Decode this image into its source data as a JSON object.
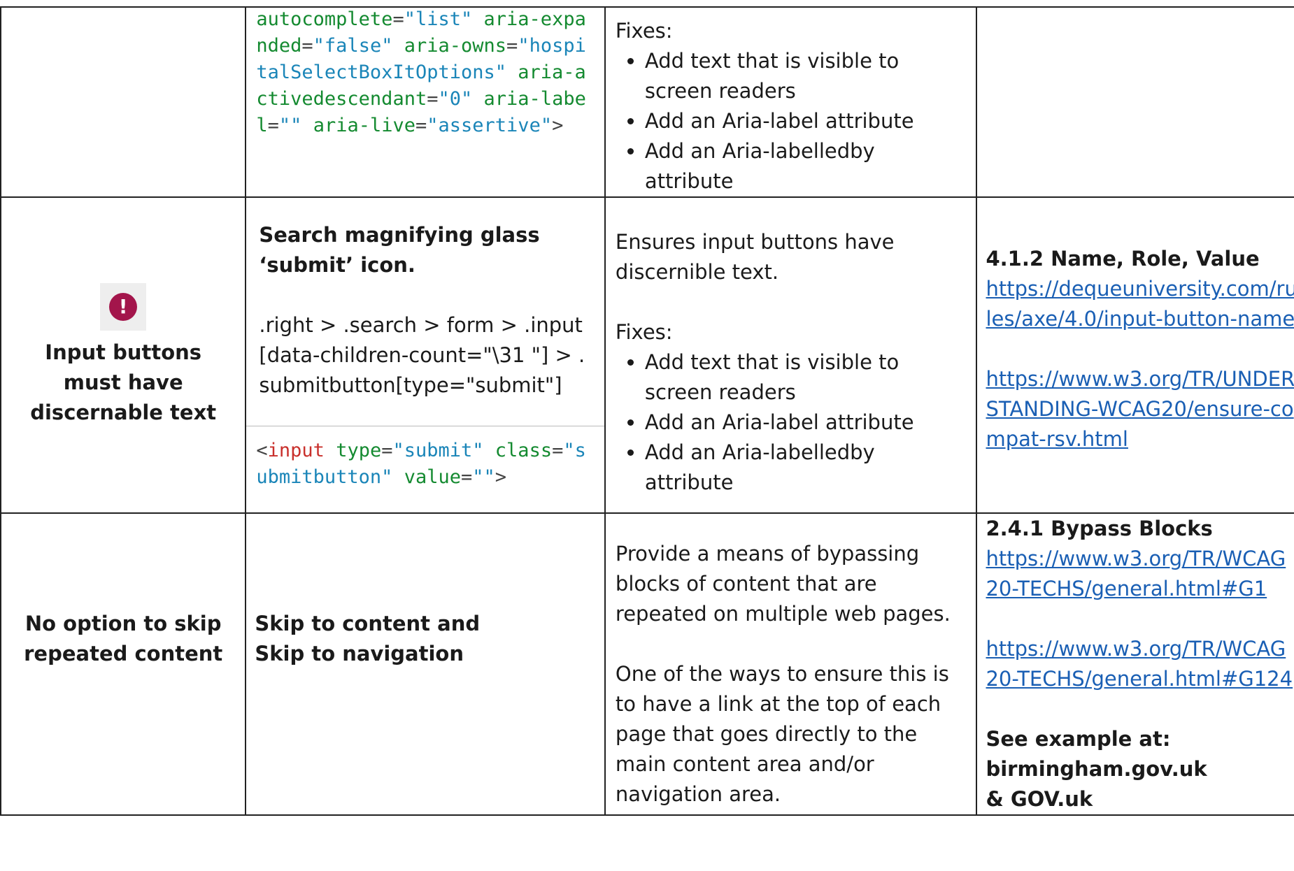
{
  "row1": {
    "code_parts": [
      {
        "t": "attr",
        "v": "autocomplete"
      },
      {
        "t": "p",
        "v": "="
      },
      {
        "t": "str",
        "v": "\"list\""
      },
      {
        "t": "sp",
        "v": " "
      },
      {
        "t": "attr",
        "v": "aria-expanded"
      },
      {
        "t": "p",
        "v": "="
      },
      {
        "t": "str",
        "v": "\"false\""
      },
      {
        "t": "sp",
        "v": " "
      },
      {
        "t": "attr",
        "v": "aria-owns"
      },
      {
        "t": "p",
        "v": "="
      },
      {
        "t": "str",
        "v": "\"hospitalSelectBoxItOptions\""
      },
      {
        "t": "sp",
        "v": " "
      },
      {
        "t": "attr",
        "v": "aria-activedescendant"
      },
      {
        "t": "p",
        "v": "="
      },
      {
        "t": "str",
        "v": "\"0\""
      },
      {
        "t": "sp",
        "v": " "
      },
      {
        "t": "attr",
        "v": "aria-label"
      },
      {
        "t": "p",
        "v": "="
      },
      {
        "t": "str",
        "v": "\"\""
      },
      {
        "t": "sp",
        "v": " "
      },
      {
        "t": "attr",
        "v": "aria-live"
      },
      {
        "t": "p",
        "v": "="
      },
      {
        "t": "str",
        "v": "\"assertive\""
      },
      {
        "t": "p",
        "v": ">"
      }
    ],
    "fixes_label": "Fixes:",
    "fixes": [
      "Add text that is visible to screen readers",
      "Add an Aria-label attribute",
      "Add an Aria-labelledby attribute"
    ]
  },
  "row2": {
    "issue": "Input buttons must have discernable text",
    "icon": "exclamation-circle-icon",
    "icon_glyph": "!",
    "element_title": "Search magnifying glass ‘submit’ icon.",
    "selector": ".right > .search > form > .input[data-children-count=\"\\31 \"] > .submitbutton[type=\"submit\"]",
    "code_parts": [
      {
        "t": "p",
        "v": "<"
      },
      {
        "t": "tag",
        "v": "input"
      },
      {
        "t": "sp",
        "v": " "
      },
      {
        "t": "attr",
        "v": "type"
      },
      {
        "t": "p",
        "v": "="
      },
      {
        "t": "str",
        "v": "\"submit\""
      },
      {
        "t": "sp",
        "v": " "
      },
      {
        "t": "attr",
        "v": "class"
      },
      {
        "t": "p",
        "v": "="
      },
      {
        "t": "str",
        "v": "\"submitbutton\""
      },
      {
        "t": "sp",
        "v": " "
      },
      {
        "t": "attr",
        "v": "value"
      },
      {
        "t": "p",
        "v": "="
      },
      {
        "t": "str",
        "v": "\"\""
      },
      {
        "t": "p",
        "v": ">"
      }
    ],
    "description": "Ensures input buttons have discernible text.",
    "fixes_label": "Fixes:",
    "fixes": [
      "Add text that is visible to screen readers",
      "Add an Aria-label attribute",
      "Add an Aria-labelledby attribute"
    ],
    "ref_title": "4.1.2 Name, Role, Value",
    "links": [
      "https://dequeuniversity.com/rules/axe/4.0/input-button-name",
      "https://www.w3.org/TR/UNDERSTANDING-WCAG20/ensure-compat-rsv.html"
    ]
  },
  "row3": {
    "issue": "No option to skip repeated content",
    "element_line1": "Skip to content and",
    "element_line2": "Skip to navigation",
    "desc_p1": "Provide a means of bypassing blocks of content that are repeated on multiple web pages.",
    "desc_p2": "One of the ways to ensure this is to have a link at the top of each page that goes directly to the main content area and/or navigation area.",
    "ref_title": "2.4.1 Bypass Blocks",
    "links": [
      "https://www.w3.org/TR/WCAG20-TECHS/general.html#G1",
      "https://www.w3.org/TR/WCAG20-TECHS/general.html#G124"
    ],
    "example_label": "See example at:",
    "example_sites": "birmingham.gov.uk & GOV.uk"
  },
  "colors": {
    "attr": "#148a30",
    "string": "#1a85b8",
    "tag": "#c9302c",
    "link": "#1a5fb4",
    "icon": "#a3154b"
  }
}
